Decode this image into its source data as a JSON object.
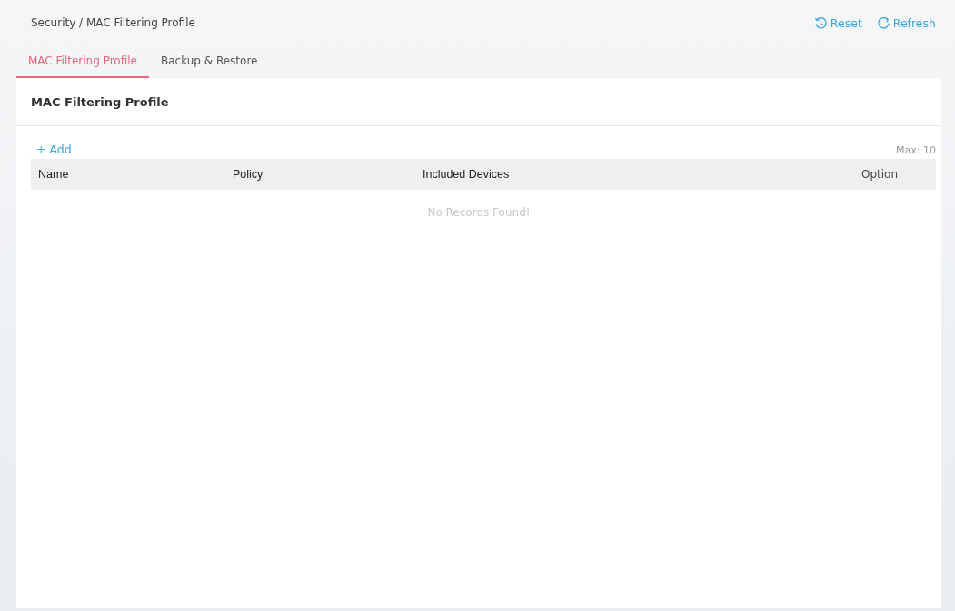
{
  "breadcrumb": "Security / MAC Filtering Profile",
  "actions": [
    {
      "kind": "reset",
      "label": "Reset"
    },
    {
      "kind": "refresh",
      "label": "Refresh"
    }
  ],
  "tabs": [
    {
      "label": "MAC Filtering Profile",
      "selected": true
    },
    {
      "label": "Backup & Restore",
      "selected": false
    }
  ],
  "panel": {
    "title": "MAC Filtering Profile",
    "add_button": "+ Add",
    "max_note": "Max: 10",
    "table": {
      "columns": [
        "Name",
        "Policy",
        "Included Devices",
        "Option"
      ],
      "empty_message": "No Records Found!"
    }
  }
}
